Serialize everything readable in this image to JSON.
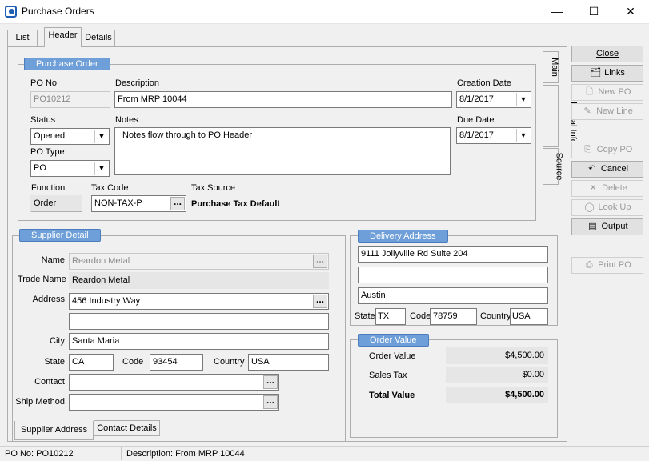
{
  "window": {
    "title": "Purchase Orders",
    "minimize": "—",
    "maximize": "☐",
    "close": "✕"
  },
  "tabs": {
    "list": "List",
    "header": "Header",
    "details": "Details"
  },
  "vertical_tabs": {
    "main": "Main",
    "additional_info": "Additional Info",
    "source": "Source"
  },
  "purchase_order": {
    "legend": "Purchase Order",
    "po_no_label": "PO No",
    "po_no": "PO10212",
    "description_label": "Description",
    "description": "From MRP 10044",
    "creation_date_label": "Creation Date",
    "creation_date": "8/1/2017",
    "status_label": "Status",
    "status": "Opened",
    "notes_label": "Notes",
    "notes": "Notes flow through to PO Header",
    "due_date_label": "Due Date",
    "due_date": "8/1/2017",
    "po_type_label": "PO Type",
    "po_type": "PO",
    "function_label": "Function",
    "function": "Order",
    "tax_code_label": "Tax Code",
    "tax_code": "NON-TAX-P",
    "tax_source_label": "Tax Source",
    "tax_source": "Purchase Tax Default"
  },
  "supplier": {
    "legend": "Supplier Detail",
    "name_label": "Name",
    "name": "Reardon Metal",
    "trade_name_label": "Trade Name",
    "trade_name": "Reardon Metal",
    "address_label": "Address",
    "address1": "456 Industry Way",
    "address2": "",
    "city_label": "City",
    "city": "Santa Maria",
    "state_label": "State",
    "state": "CA",
    "code_label": "Code",
    "code": "93454",
    "country_label": "Country",
    "country": "USA",
    "contact_label": "Contact",
    "contact": "",
    "ship_method_label": "Ship Method",
    "ship_method": "",
    "subtab_address": "Supplier Address",
    "subtab_contact": "Contact Details"
  },
  "delivery": {
    "legend": "Delivery Address",
    "line1": "9111 Jollyville Rd Suite 204",
    "line2": "",
    "city": "Austin",
    "state_label": "State",
    "state": "TX",
    "code_label": "Code",
    "code": "78759",
    "country_label": "Country",
    "country": "USA"
  },
  "order_value": {
    "legend": "Order Value",
    "order_value_label": "Order Value",
    "order_value": "$4,500.00",
    "sales_tax_label": "Sales Tax",
    "sales_tax": "$0.00",
    "total_value_label": "Total Value",
    "total_value": "$4,500.00"
  },
  "side_buttons": {
    "close": "Close",
    "links": "Links",
    "new_po": "New PO",
    "new_line": "New Line",
    "copy_po": "Copy PO",
    "cancel": "Cancel",
    "delete": "Delete",
    "look_up": "Look Up",
    "output": "Output",
    "print_po": "Print PO"
  },
  "statusbar": {
    "po_no": "PO No: PO10212",
    "description": "Description: From MRP 10044"
  },
  "icons": {
    "dropdown": "▼",
    "ellipsis": "..."
  },
  "colors": {
    "legend_bg": "#6f9fd8",
    "window_bg": "#f0f0f0"
  }
}
